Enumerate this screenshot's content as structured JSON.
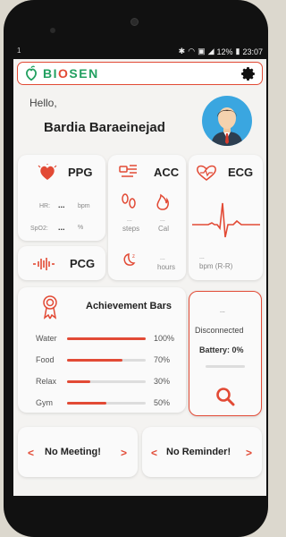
{
  "status": {
    "left": "1",
    "battery_pct": "12%",
    "time": "23:07"
  },
  "app": {
    "logo_prefix": "BI",
    "logo_o": "O",
    "logo_suffix": "SEN",
    "accent": "#e24a35",
    "brand_green": "#22a060"
  },
  "greeting": {
    "hello": "Hello,",
    "name": "Bardia Baraeinejad"
  },
  "ppg": {
    "title": "PPG",
    "hr_label": "HR:",
    "hr_value": "...",
    "hr_unit": "bpm",
    "spo2_label": "SpO2:",
    "spo2_value": "...",
    "spo2_unit": "%"
  },
  "acc": {
    "title": "ACC",
    "steps_value": "...",
    "steps_unit": "steps",
    "cal_value": "...",
    "cal_unit": "Cal",
    "sleep_value": "...",
    "sleep_unit": "hours"
  },
  "ecg": {
    "title": "ECG",
    "value": "...",
    "unit": "bpm (R-R)"
  },
  "pcg": {
    "title": "PCG"
  },
  "achievements": {
    "title": "Achievement Bars",
    "items": [
      {
        "label": "Water",
        "pct_text": "100%",
        "fraction": 1.0
      },
      {
        "label": "Food",
        "pct_text": "70%",
        "fraction": 0.7
      },
      {
        "label": "Relax",
        "pct_text": "30%",
        "fraction": 0.3
      },
      {
        "label": "Gym",
        "pct_text": "50%",
        "fraction": 0.5
      }
    ]
  },
  "device": {
    "dots": "...",
    "status": "Disconnected",
    "battery": "Battery: 0%",
    "battery_fraction": 0
  },
  "meeting": {
    "prev": "<",
    "label": "No Meeting!",
    "next": ">"
  },
  "reminder": {
    "prev": "<",
    "label": "No Reminder!",
    "next": ">"
  }
}
